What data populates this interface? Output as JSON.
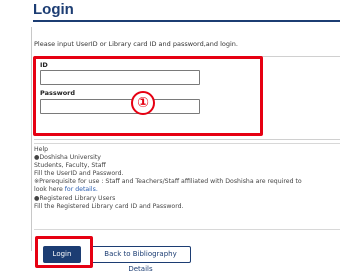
{
  "page": {
    "title": "Login",
    "instruction": "Please input UserID or Library card ID and password,and login."
  },
  "form": {
    "id_label": "ID",
    "id_value": "",
    "password_label": "Password",
    "password_value": "",
    "annotation_marker": "①"
  },
  "help": {
    "heading": "Help",
    "lines": [
      "●Doshisha University",
      "Students, Faculty, Staff",
      "Fill the UserID and Password.",
      "※Prerequisite for use : Staff and Teachers/Staff affiliated with Doshisha are required to",
      "look here ",
      "●Registered Library Users",
      "Fill the Registered Library card ID and Password."
    ],
    "details_link": "for details."
  },
  "buttons": {
    "login": "Login",
    "back": "Back to Bibliography Details"
  },
  "colors": {
    "accent": "#1c3d73",
    "highlight": "#e60012"
  }
}
